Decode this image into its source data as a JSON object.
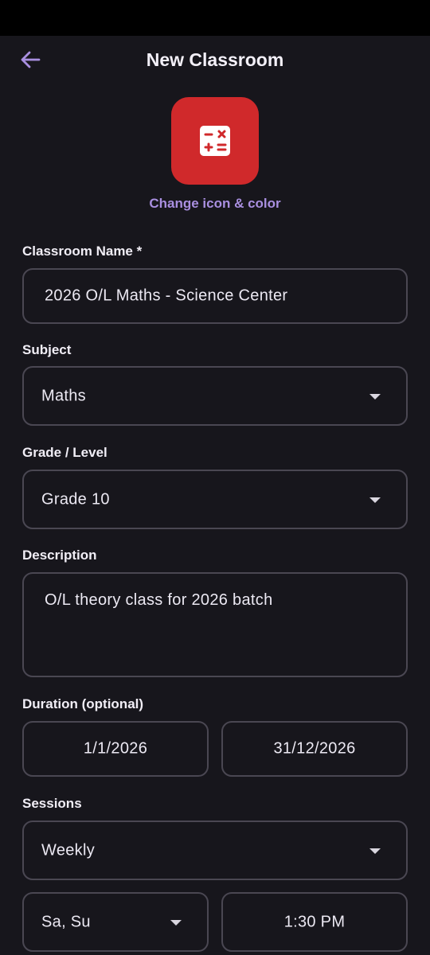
{
  "header": {
    "title": "New Classroom"
  },
  "icon_picker": {
    "link_label": "Change icon & color",
    "tile_color": "#d0292b",
    "accent_color": "#a98fe0"
  },
  "form": {
    "classroom_name": {
      "label": "Classroom Name *",
      "value": "2026 O/L Maths - Science Center"
    },
    "subject": {
      "label": "Subject",
      "value": "Maths"
    },
    "grade": {
      "label": "Grade / Level",
      "value": "Grade 10"
    },
    "description": {
      "label": "Description",
      "value": "O/L theory class for 2026 batch"
    },
    "duration": {
      "label": "Duration (optional)",
      "start": "1/1/2026",
      "end": "31/12/2026"
    },
    "sessions": {
      "label": "Sessions",
      "frequency": "Weekly",
      "days": "Sa, Su",
      "time": "1:30 PM"
    }
  }
}
